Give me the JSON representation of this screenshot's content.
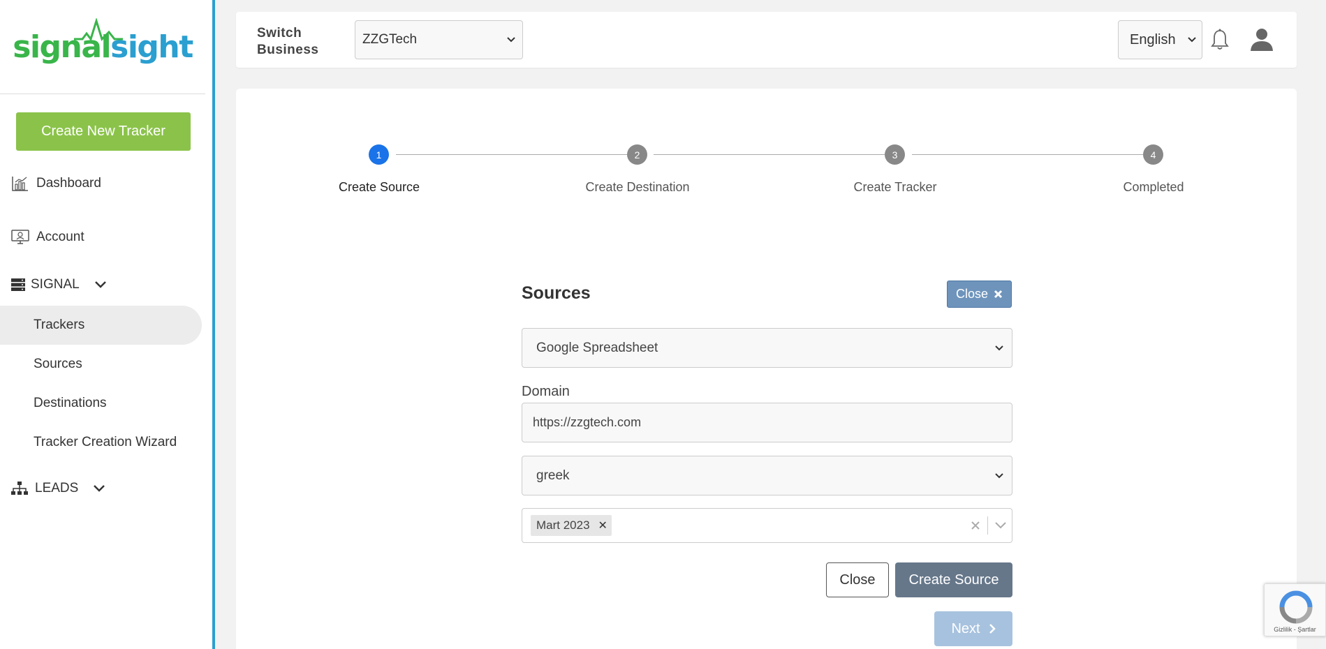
{
  "brand": {
    "part1": "signal",
    "part2": "sight"
  },
  "sidebar": {
    "create_button": "Create New Tracker",
    "dashboard": "Dashboard",
    "account": "Account",
    "signal_section": "SIGNAL",
    "trackers": "Trackers",
    "sources": "Sources",
    "destinations": "Destinations",
    "wizard": "Tracker Creation Wizard",
    "leads_section": "LEADS"
  },
  "topbar": {
    "switch_label_line1": "Switch",
    "switch_label_line2": "Business",
    "business_value": "ZZGTech",
    "language_value": "English"
  },
  "stepper": {
    "steps": [
      {
        "number": "1",
        "label": "Create Source"
      },
      {
        "number": "2",
        "label": "Create Destination"
      },
      {
        "number": "3",
        "label": "Create Tracker"
      },
      {
        "number": "4",
        "label": "Completed"
      }
    ]
  },
  "form": {
    "title": "Sources",
    "close_top_label": "Close",
    "source_type": "Google Spreadsheet",
    "domain_label": "Domain",
    "domain_value": "https://zzgtech.com",
    "sheet_value": "greek",
    "tag_value": "Mart 2023",
    "close_label": "Close",
    "create_label": "Create Source",
    "next_label": "Next"
  },
  "recaptcha": {
    "footer": "Gizlilik - Şartlar"
  },
  "colors": {
    "accent_blue": "#2a9fd0",
    "brand_green": "#39b54a",
    "create_button": "#8bc34a",
    "step_active": "#1a73e8"
  }
}
